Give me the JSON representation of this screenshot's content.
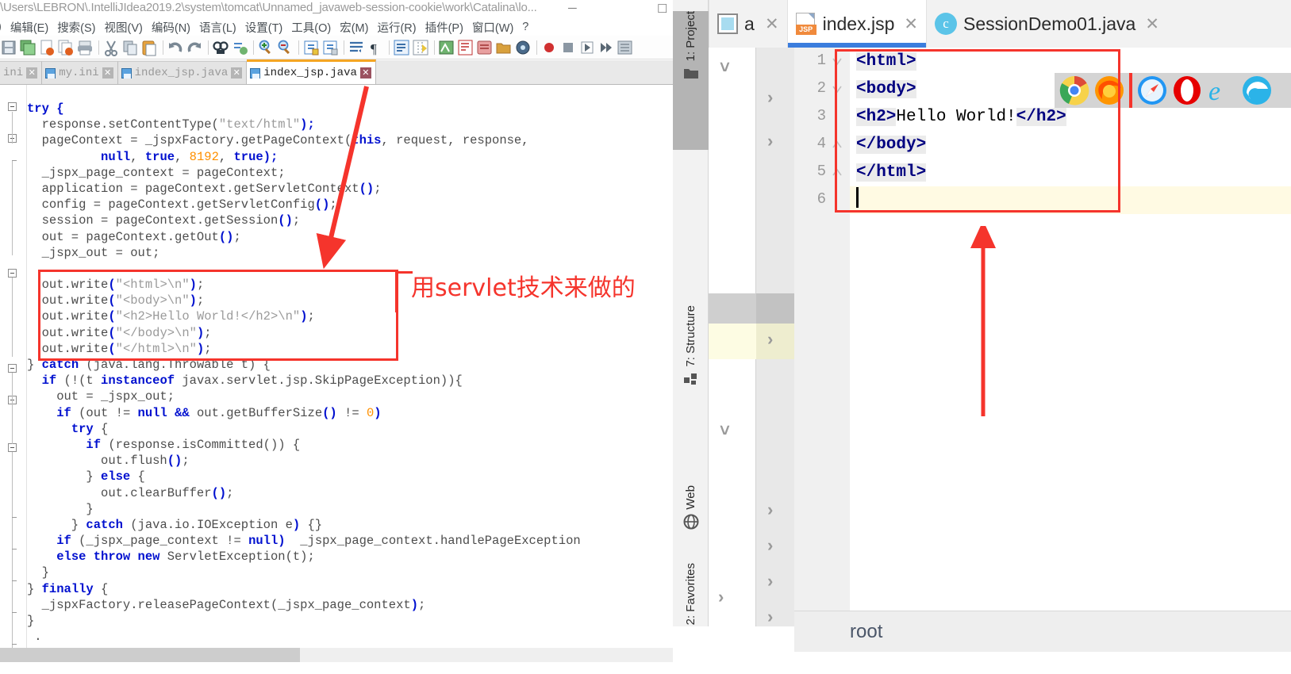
{
  "notepad": {
    "title": "\\Users\\LEBRON\\.IntelliJIdea2019.2\\system\\tomcat\\Unnamed_javaweb-session-cookie\\work\\Catalina\\lo...",
    "window_minimize": "─",
    "window_maximize": "☐",
    "menu": [
      ")",
      "编辑(E)",
      "搜索(S)",
      "视图(V)",
      "编码(N)",
      "语言(L)",
      "设置(T)",
      "工具(O)",
      "宏(M)",
      "运行(R)",
      "插件(P)",
      "窗口(W)",
      "?"
    ],
    "toolbar_icons": [
      "save-icon",
      "save-all-icon",
      "close-file-icon",
      "close-all-icon",
      "print-icon",
      "cut-icon",
      "copy-icon",
      "paste-icon",
      "undo-icon",
      "redo-icon",
      "find-icon",
      "replace-icon",
      "zoom-in-icon",
      "zoom-out-icon",
      "sync-scroll-icon",
      "sync-scroll-off-icon",
      "word-wrap-icon",
      "pilcrow-icon",
      "all-chars-icon",
      "indent-guide-icon",
      "lang-icon",
      "doc-map-icon",
      "function-list-icon",
      "folder-icon",
      "monitor-icon",
      "record-macro-icon",
      "stop-macro-icon",
      "play-macro-icon",
      "play-multi-icon",
      "manage-macro-icon"
    ],
    "tabs": [
      {
        "label": "ini",
        "active": false
      },
      {
        "label": "my.ini",
        "active": false
      },
      {
        "label": "index_jsp.java",
        "active": false
      },
      {
        "label": "index_jsp.java",
        "active": true
      }
    ],
    "annotation": "用servlet技术来做的",
    "code": [
      [
        {
          "t": "try",
          "c": "kw"
        },
        {
          "t": " {",
          "c": "punc"
        }
      ],
      [
        {
          "t": "  response.setContentType(",
          "c": ""
        },
        {
          "t": "\"text/html\"",
          "c": "str"
        },
        {
          "t": ");",
          "c": "punc"
        }
      ],
      [
        {
          "t": "  pageContext = _jspxFactory.getPageContext(",
          "c": ""
        },
        {
          "t": "this",
          "c": "kw"
        },
        {
          "t": ", request, response,",
          "c": ""
        }
      ],
      [
        {
          "t": "          ",
          "c": ""
        },
        {
          "t": "null",
          "c": "kw"
        },
        {
          "t": ", ",
          "c": ""
        },
        {
          "t": "true",
          "c": "kw"
        },
        {
          "t": ", ",
          "c": ""
        },
        {
          "t": "8192",
          "c": "num"
        },
        {
          "t": ", ",
          "c": ""
        },
        {
          "t": "true",
          "c": "kw"
        },
        {
          "t": ");",
          "c": "punc"
        }
      ],
      [
        {
          "t": "  _jspx_page_context = pageContext;",
          "c": ""
        }
      ],
      [
        {
          "t": "  application = pageContext.getServletContext",
          "c": ""
        },
        {
          "t": "()",
          "c": "punc"
        },
        {
          "t": ";",
          "c": ""
        }
      ],
      [
        {
          "t": "  config = pageContext.getServletConfig",
          "c": ""
        },
        {
          "t": "()",
          "c": "punc"
        },
        {
          "t": ";",
          "c": ""
        }
      ],
      [
        {
          "t": "  session = pageContext.getSession",
          "c": ""
        },
        {
          "t": "()",
          "c": "punc"
        },
        {
          "t": ";",
          "c": ""
        }
      ],
      [
        {
          "t": "  out = pageContext.getOut",
          "c": ""
        },
        {
          "t": "()",
          "c": "punc"
        },
        {
          "t": ";",
          "c": ""
        }
      ],
      [
        {
          "t": "  _jspx_out = out;",
          "c": ""
        }
      ],
      [
        {
          "t": "",
          "c": ""
        }
      ],
      [
        {
          "t": "  out.write",
          "c": ""
        },
        {
          "t": "(",
          "c": "punc"
        },
        {
          "t": "\"<html>\\n\"",
          "c": "str"
        },
        {
          "t": ")",
          "c": "punc"
        },
        {
          "t": ";",
          "c": ""
        }
      ],
      [
        {
          "t": "  out.write",
          "c": ""
        },
        {
          "t": "(",
          "c": "punc"
        },
        {
          "t": "\"<body>\\n\"",
          "c": "str"
        },
        {
          "t": ")",
          "c": "punc"
        },
        {
          "t": ";",
          "c": ""
        }
      ],
      [
        {
          "t": "  out.write",
          "c": ""
        },
        {
          "t": "(",
          "c": "punc"
        },
        {
          "t": "\"<h2>Hello World!</h2>\\n\"",
          "c": "str"
        },
        {
          "t": ")",
          "c": "punc"
        },
        {
          "t": ";",
          "c": ""
        }
      ],
      [
        {
          "t": "  out.write",
          "c": ""
        },
        {
          "t": "(",
          "c": "punc"
        },
        {
          "t": "\"</body>\\n\"",
          "c": "str"
        },
        {
          "t": ")",
          "c": "punc"
        },
        {
          "t": ";",
          "c": ""
        }
      ],
      [
        {
          "t": "  out.write",
          "c": ""
        },
        {
          "t": "(",
          "c": "punc"
        },
        {
          "t": "\"</html>\\n\"",
          "c": "str"
        },
        {
          "t": ")",
          "c": "punc"
        },
        {
          "t": ";",
          "c": ""
        }
      ],
      [
        {
          "t": "} ",
          "c": ""
        },
        {
          "t": "catch",
          "c": "kw"
        },
        {
          "t": " (java.lang.Throwable t) {",
          "c": ""
        }
      ],
      [
        {
          "t": "  ",
          "c": ""
        },
        {
          "t": "if",
          "c": "kw"
        },
        {
          "t": " (!(t ",
          "c": ""
        },
        {
          "t": "instanceof",
          "c": "kw"
        },
        {
          "t": " javax.servlet.jsp.SkipPageException)){",
          "c": ""
        }
      ],
      [
        {
          "t": "    out = _jspx_out;",
          "c": ""
        }
      ],
      [
        {
          "t": "    ",
          "c": ""
        },
        {
          "t": "if",
          "c": "kw"
        },
        {
          "t": " (out != ",
          "c": ""
        },
        {
          "t": "null",
          "c": "kw"
        },
        {
          "t": " ",
          "c": ""
        },
        {
          "t": "&&",
          "c": "kw"
        },
        {
          "t": " out.getBufferSize",
          "c": ""
        },
        {
          "t": "()",
          "c": "punc"
        },
        {
          "t": " != ",
          "c": ""
        },
        {
          "t": "0",
          "c": "num"
        },
        {
          "t": ")",
          "c": "punc"
        }
      ],
      [
        {
          "t": "      ",
          "c": ""
        },
        {
          "t": "try",
          "c": "kw"
        },
        {
          "t": " {",
          "c": ""
        }
      ],
      [
        {
          "t": "        ",
          "c": ""
        },
        {
          "t": "if",
          "c": "kw"
        },
        {
          "t": " (response.isCommitted()) {",
          "c": ""
        }
      ],
      [
        {
          "t": "          out.flush",
          "c": ""
        },
        {
          "t": "()",
          "c": "punc"
        },
        {
          "t": ";",
          "c": ""
        }
      ],
      [
        {
          "t": "        } ",
          "c": ""
        },
        {
          "t": "else",
          "c": "kw"
        },
        {
          "t": " {",
          "c": ""
        }
      ],
      [
        {
          "t": "          out.clearBuffer",
          "c": ""
        },
        {
          "t": "()",
          "c": "punc"
        },
        {
          "t": ";",
          "c": ""
        }
      ],
      [
        {
          "t": "        }",
          "c": ""
        }
      ],
      [
        {
          "t": "      } ",
          "c": ""
        },
        {
          "t": "catch",
          "c": "kw"
        },
        {
          "t": " (java.io.IOException e",
          "c": ""
        },
        {
          "t": ")",
          "c": "punc"
        },
        {
          "t": " {}",
          "c": ""
        }
      ],
      [
        {
          "t": "    ",
          "c": ""
        },
        {
          "t": "if",
          "c": "kw"
        },
        {
          "t": " (_jspx_page_context != ",
          "c": ""
        },
        {
          "t": "null",
          "c": "kw"
        },
        {
          "t": ")",
          "c": "punc"
        },
        {
          "t": "  _jspx_page_context.handlePageException",
          "c": ""
        }
      ],
      [
        {
          "t": "    ",
          "c": ""
        },
        {
          "t": "else throw new",
          "c": "kw"
        },
        {
          "t": " ServletException(t);",
          "c": ""
        }
      ],
      [
        {
          "t": "  }",
          "c": ""
        }
      ],
      [
        {
          "t": "} ",
          "c": ""
        },
        {
          "t": "finally",
          "c": "kw"
        },
        {
          "t": " {",
          "c": ""
        }
      ],
      [
        {
          "t": "  _jspxFactory.releasePageContext(_jspx_page_context",
          "c": ""
        },
        {
          "t": ")",
          "c": "punc"
        },
        {
          "t": ";",
          "c": ""
        }
      ],
      [
        {
          "t": "}",
          "c": ""
        }
      ],
      [
        {
          "t": " .",
          "c": ""
        }
      ]
    ]
  },
  "idea": {
    "sidebar_tabs": [
      {
        "label": "1: Project",
        "icon": "folder-icon",
        "selected": true
      },
      {
        "label": "7: Structure",
        "icon": "structure-icon",
        "selected": false
      },
      {
        "label": "Web",
        "icon": "globe-icon",
        "selected": false
      },
      {
        "label": "2: Favorites",
        "icon": "star-icon",
        "selected": false
      }
    ],
    "editor_tabs": [
      {
        "label": "a",
        "icon": "blue-square-icon",
        "active": false,
        "truncated": true
      },
      {
        "label": "index.jsp",
        "icon": "jsp-icon",
        "active": true
      },
      {
        "label": "SessionDemo01.java",
        "icon": "class-icon",
        "active": false
      }
    ],
    "tab_close_glyph": "✕",
    "jsp_badge": "JSP",
    "class_badge": "c",
    "line_numbers": [
      "1",
      "2",
      "3",
      "4",
      "5",
      "6"
    ],
    "editor_lines": [
      {
        "n": "1",
        "tag": "<html>",
        "text": "",
        "tail": "",
        "fold": true
      },
      {
        "n": "2",
        "tag": "<body>",
        "text": "",
        "tail": "",
        "fold": true
      },
      {
        "n": "3",
        "tag": "<h2>",
        "text": "Hello World!",
        "tail": "</h2>",
        "fold": false
      },
      {
        "n": "4",
        "tag": "</body>",
        "text": "",
        "tail": "",
        "fold": true
      },
      {
        "n": "5",
        "tag": "</html>",
        "text": "",
        "tail": "",
        "fold": true
      },
      {
        "n": "6",
        "tag": "",
        "text": "",
        "tail": "",
        "fold": false
      }
    ],
    "browsers": [
      "chrome-icon",
      "firefox-icon",
      "safari-icon",
      "opera-icon",
      "ie-icon",
      "edge-icon"
    ],
    "status_text": "root"
  },
  "colors": {
    "annotation_red": "#f5342c",
    "tab_accent_blue": "#3b7ddd",
    "npp_active_tab_orange": "#f5a623",
    "keyword_blue": "#0010cf",
    "string_gray": "#9a9a9a",
    "number_orange": "#ff9000",
    "idea_tag_navy": "#000080"
  }
}
